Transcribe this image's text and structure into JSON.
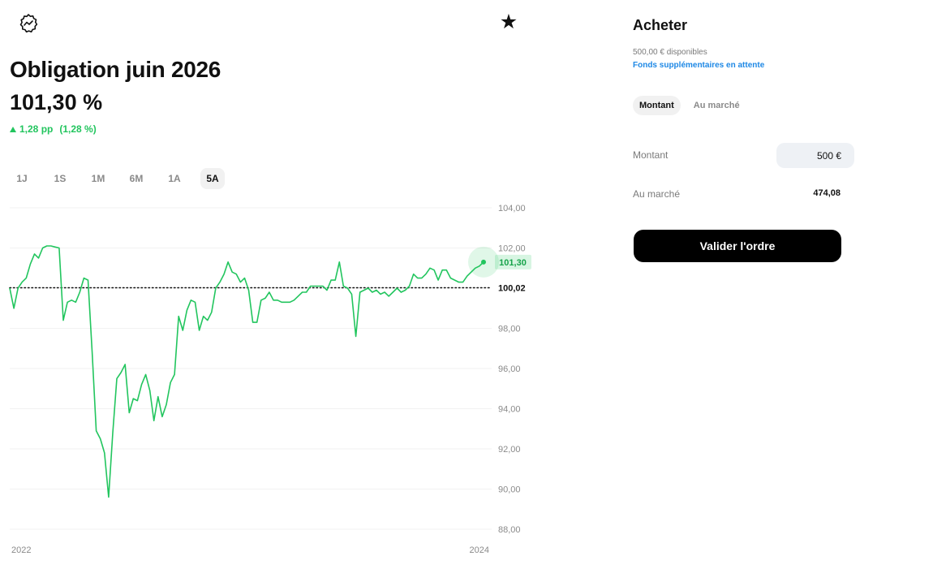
{
  "header": {
    "logo_icon": "logo-badge-icon",
    "favorite_icon": "star-icon",
    "title": "Obligation juin 2026",
    "price": "101,30 %",
    "change_abs": "1,28 pp",
    "change_pct": "(1,28 %)",
    "change_color": "#22c55e"
  },
  "ranges": [
    {
      "label": "1J",
      "active": false
    },
    {
      "label": "1S",
      "active": false
    },
    {
      "label": "1M",
      "active": false
    },
    {
      "label": "6M",
      "active": false
    },
    {
      "label": "1A",
      "active": false
    },
    {
      "label": "5A",
      "active": true
    }
  ],
  "chart_data": {
    "type": "line",
    "line_color": "#22c55e",
    "ylim": [
      88,
      104
    ],
    "y_ticks": [
      "104,00",
      "102,00",
      "100,02",
      "98,00",
      "96,00",
      "94,00",
      "92,00",
      "90,00",
      "88,00"
    ],
    "y_tick_values": [
      104,
      102,
      100.02,
      98,
      96,
      94,
      92,
      90,
      88
    ],
    "reference_value": 100.02,
    "reference_label": "100,02",
    "current_value": 101.3,
    "current_label": "101,30",
    "x_labels": [
      "2022",
      "2024"
    ],
    "grid": true,
    "values": [
      100.0,
      99.0,
      100.0,
      100.3,
      100.5,
      101.2,
      101.7,
      101.5,
      102.0,
      102.1,
      102.1,
      102.05,
      102.0,
      98.4,
      99.3,
      99.4,
      99.3,
      99.8,
      100.5,
      100.4,
      96.8,
      92.9,
      92.5,
      91.8,
      89.6,
      92.8,
      95.5,
      95.8,
      96.2,
      93.8,
      94.5,
      94.4,
      95.2,
      95.7,
      94.9,
      93.4,
      94.6,
      93.6,
      94.2,
      95.3,
      95.7,
      98.6,
      97.9,
      98.9,
      99.4,
      99.3,
      97.9,
      98.6,
      98.4,
      98.8,
      100.0,
      100.3,
      100.7,
      101.3,
      100.8,
      100.7,
      100.3,
      100.5,
      99.9,
      98.3,
      98.3,
      99.4,
      99.5,
      99.8,
      99.4,
      99.4,
      99.3,
      99.3,
      99.3,
      99.4,
      99.6,
      99.8,
      99.8,
      100.1,
      100.1,
      100.1,
      100.1,
      99.9,
      100.4,
      100.4,
      101.3,
      100.1,
      100.0,
      99.7,
      97.6,
      99.8,
      99.9,
      100.0,
      99.8,
      99.9,
      99.7,
      99.8,
      99.6,
      99.8,
      100.0,
      99.8,
      99.9,
      100.1,
      100.7,
      100.5,
      100.5,
      100.7,
      101.0,
      100.9,
      100.4,
      100.9,
      100.9,
      100.5,
      100.4,
      100.3,
      100.3,
      100.6,
      100.8,
      101.0,
      101.1,
      101.3
    ]
  },
  "order": {
    "title": "Acheter",
    "available": "500,00 € disponibles",
    "pending": "Fonds supplémentaires en attente",
    "tabs": [
      {
        "label": "Montant",
        "active": true
      },
      {
        "label": "Au marché",
        "active": false
      }
    ],
    "amount_label": "Montant",
    "amount_value": "500 €",
    "market_label": "Au marché",
    "market_value": "474,08",
    "submit_label": "Valider l'ordre"
  }
}
